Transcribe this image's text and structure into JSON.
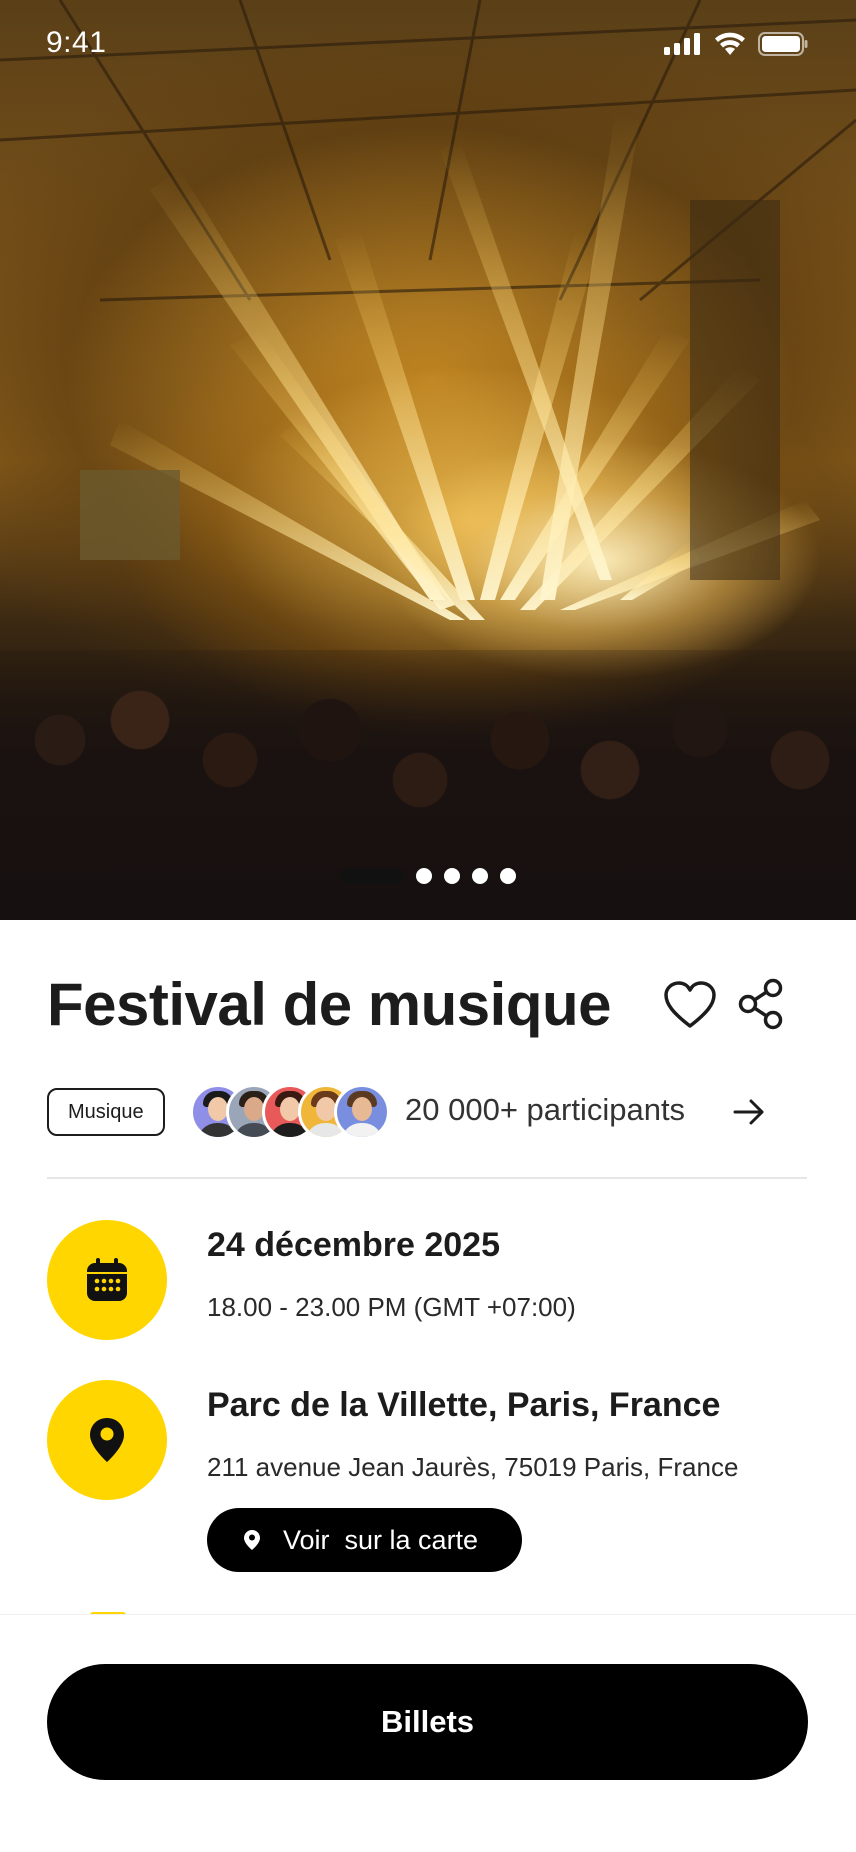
{
  "status_bar": {
    "time": "9:41"
  },
  "hero": {
    "image_subject": "concert stage with yellow lights and crowd",
    "carousel": {
      "count": 5,
      "active_index": 0
    }
  },
  "event": {
    "title": "Festival de musique",
    "tag": "Musique",
    "participants_label": "20 000+ participants"
  },
  "date": {
    "title": "24 décembre 2025",
    "time": "18.00 - 23.00 PM (GMT +07:00)"
  },
  "location": {
    "title": "Parc de la Villette, Paris, France",
    "address": "211 avenue Jean Jaurès, 75019 Paris, France",
    "map_button_label": "Voir  sur la carte"
  },
  "cta": {
    "label": "Billets"
  },
  "colors": {
    "accent": "#FFD600",
    "primary_button": "#000000",
    "text": "#1C1C1C"
  },
  "icons": {
    "like": "heart-icon",
    "share": "share-icon",
    "arrow": "arrow-right-icon",
    "calendar": "calendar-icon",
    "location": "location-pin-icon"
  }
}
